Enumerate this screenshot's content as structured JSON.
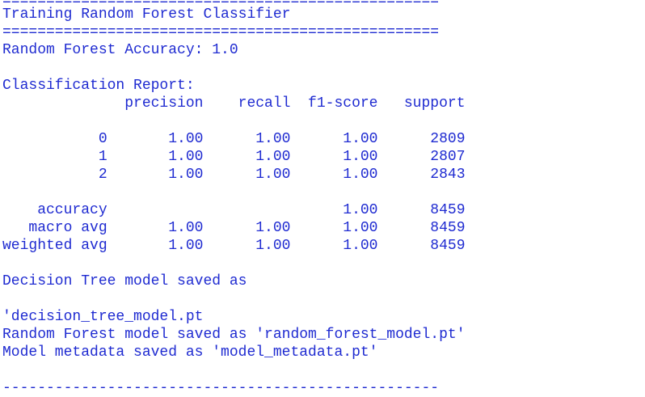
{
  "theme": {
    "text_color": "#1f2bd1",
    "background": "#ffffff"
  },
  "console": {
    "lines": [
      "==================================================",
      "Training Random Forest Classifier",
      "==================================================",
      "Random Forest Accuracy: 1.0",
      "",
      "Classification Report:",
      "              precision    recall  f1-score   support",
      "",
      "           0       1.00      1.00      1.00      2809",
      "           1       1.00      1.00      1.00      2807",
      "           2       1.00      1.00      1.00      2843",
      "",
      "    accuracy                           1.00      8459",
      "   macro avg       1.00      1.00      1.00      8459",
      "weighted avg       1.00      1.00      1.00      8459",
      "",
      "Decision Tree model saved as",
      "",
      "'decision_tree_model.pt",
      "Random Forest model saved as 'random_forest_model.pt'",
      "Model metadata saved as 'model_metadata.pt'",
      "",
      "--------------------------------------------------"
    ]
  }
}
